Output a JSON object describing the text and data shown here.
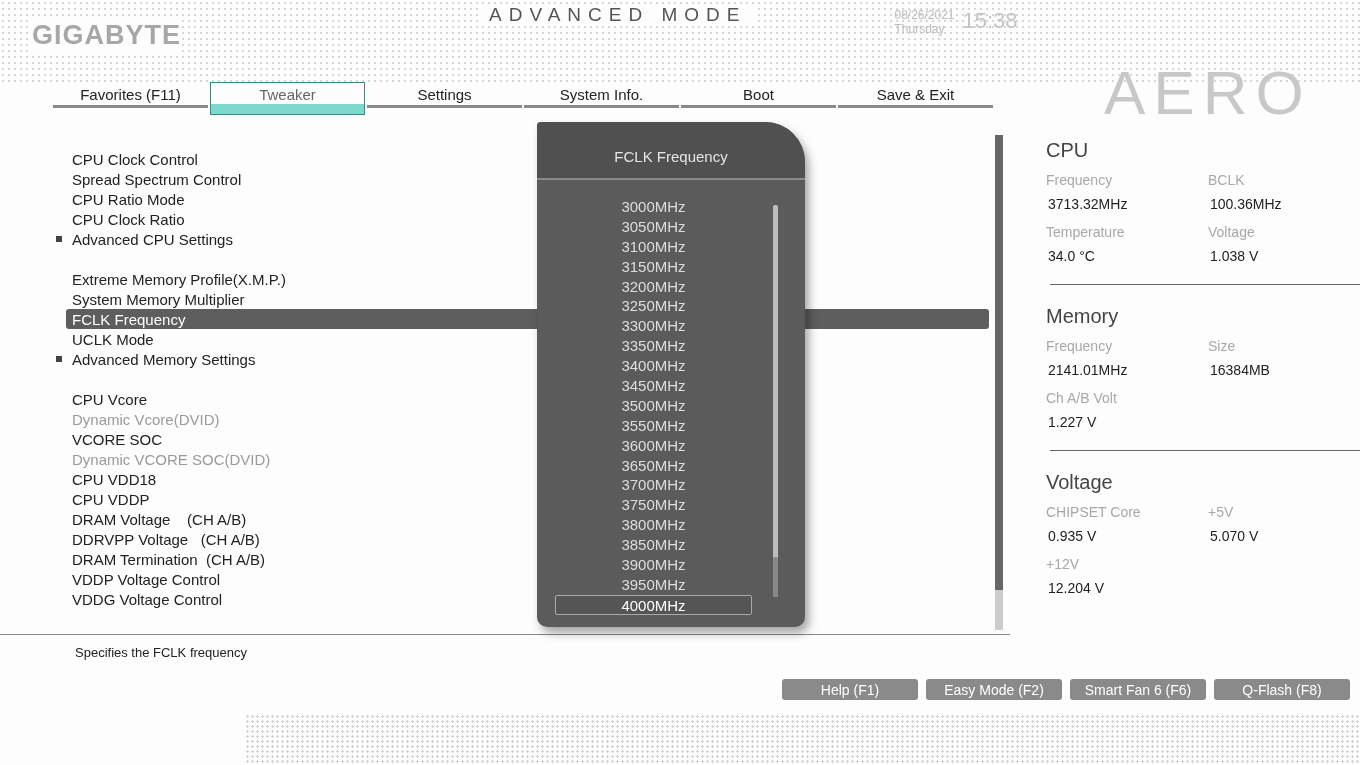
{
  "header": {
    "brand": "GIGABYTE",
    "title": "ADVANCED MODE",
    "date": "08/26/2021",
    "day": "Thursday",
    "time": "15:38",
    "logo": "AERO"
  },
  "tabs": [
    {
      "label": "Favorites (F11)",
      "selected": false
    },
    {
      "label": "Tweaker",
      "selected": true
    },
    {
      "label": "Settings",
      "selected": false
    },
    {
      "label": "System Info.",
      "selected": false
    },
    {
      "label": "Boot",
      "selected": false
    },
    {
      "label": "Save & Exit",
      "selected": false
    }
  ],
  "settings": [
    {
      "items": [
        {
          "label": "CPU Clock Control",
          "kind": "item",
          "disabled": false,
          "selected": false
        },
        {
          "label": "Spread Spectrum Control",
          "kind": "item",
          "disabled": false,
          "selected": false
        },
        {
          "label": "CPU Ratio Mode",
          "kind": "item",
          "disabled": false,
          "selected": false
        },
        {
          "label": "CPU Clock Ratio",
          "kind": "item",
          "disabled": false,
          "selected": false
        },
        {
          "label": "Advanced CPU Settings",
          "kind": "submenu",
          "disabled": false,
          "selected": false
        }
      ]
    },
    {
      "items": [
        {
          "label": "Extreme Memory Profile(X.M.P.)",
          "kind": "item",
          "disabled": false,
          "selected": false
        },
        {
          "label": "System Memory Multiplier",
          "kind": "item",
          "disabled": false,
          "selected": false
        },
        {
          "label": "FCLK Frequency",
          "kind": "item",
          "disabled": false,
          "selected": true
        },
        {
          "label": "UCLK Mode",
          "kind": "item",
          "disabled": false,
          "selected": false
        },
        {
          "label": "Advanced Memory Settings",
          "kind": "submenu",
          "disabled": false,
          "selected": false
        }
      ]
    },
    {
      "items": [
        {
          "label": "CPU Vcore",
          "kind": "item",
          "disabled": false,
          "selected": false
        },
        {
          "label": "Dynamic Vcore(DVID)",
          "kind": "item",
          "disabled": true,
          "selected": false
        },
        {
          "label": "VCORE SOC",
          "kind": "item",
          "disabled": false,
          "selected": false
        },
        {
          "label": "Dynamic VCORE SOC(DVID)",
          "kind": "item",
          "disabled": true,
          "selected": false
        },
        {
          "label": "CPU VDD18",
          "kind": "item",
          "disabled": false,
          "selected": false
        },
        {
          "label": "CPU VDDP",
          "kind": "item",
          "disabled": false,
          "selected": false
        },
        {
          "label": "DRAM Voltage    (CH A/B)",
          "kind": "item",
          "disabled": false,
          "selected": false
        },
        {
          "label": "DDRVPP Voltage   (CH A/B)",
          "kind": "item",
          "disabled": false,
          "selected": false
        },
        {
          "label": "DRAM Termination  (CH A/B)",
          "kind": "item",
          "disabled": false,
          "selected": false
        },
        {
          "label": "VDDP Voltage Control",
          "kind": "item",
          "disabled": false,
          "selected": false
        },
        {
          "label": "VDDG Voltage Control",
          "kind": "item",
          "disabled": false,
          "selected": false
        }
      ]
    }
  ],
  "popup": {
    "title": "FCLK Frequency",
    "options": [
      {
        "label": "3000MHz",
        "selected": false
      },
      {
        "label": "3050MHz",
        "selected": false
      },
      {
        "label": "3100MHz",
        "selected": false
      },
      {
        "label": "3150MHz",
        "selected": false
      },
      {
        "label": "3200MHz",
        "selected": false
      },
      {
        "label": "3250MHz",
        "selected": false
      },
      {
        "label": "3300MHz",
        "selected": false
      },
      {
        "label": "3350MHz",
        "selected": false
      },
      {
        "label": "3400MHz",
        "selected": false
      },
      {
        "label": "3450MHz",
        "selected": false
      },
      {
        "label": "3500MHz",
        "selected": false
      },
      {
        "label": "3550MHz",
        "selected": false
      },
      {
        "label": "3600MHz",
        "selected": false
      },
      {
        "label": "3650MHz",
        "selected": false
      },
      {
        "label": "3700MHz",
        "selected": false
      },
      {
        "label": "3750MHz",
        "selected": false
      },
      {
        "label": "3800MHz",
        "selected": false
      },
      {
        "label": "3850MHz",
        "selected": false
      },
      {
        "label": "3900MHz",
        "selected": false
      },
      {
        "label": "3950MHz",
        "selected": false
      },
      {
        "label": "4000MHz",
        "selected": true
      }
    ]
  },
  "info": [
    {
      "title": "CPU",
      "fields": [
        {
          "label": "Frequency",
          "value": "3713.32MHz"
        },
        {
          "label": "BCLK",
          "value": "100.36MHz"
        },
        {
          "label": "Temperature",
          "value": "34.0 °C"
        },
        {
          "label": "Voltage",
          "value": "1.038 V"
        }
      ]
    },
    {
      "title": "Memory",
      "fields": [
        {
          "label": "Frequency",
          "value": "2141.01MHz"
        },
        {
          "label": "Size",
          "value": "16384MB"
        },
        {
          "label": "Ch A/B Volt",
          "value": "1.227 V"
        }
      ]
    },
    {
      "title": "Voltage",
      "fields": [
        {
          "label": "CHIPSET Core",
          "value": "0.935 V"
        },
        {
          "label": "+5V",
          "value": "5.070 V"
        },
        {
          "label": "+12V",
          "value": "12.204 V"
        }
      ]
    }
  ],
  "help_text": "Specifies the FCLK frequency",
  "buttons": [
    "Help (F1)",
    "Easy Mode (F2)",
    "Smart Fan 6 (F6)",
    "Q-Flash (F8)"
  ]
}
